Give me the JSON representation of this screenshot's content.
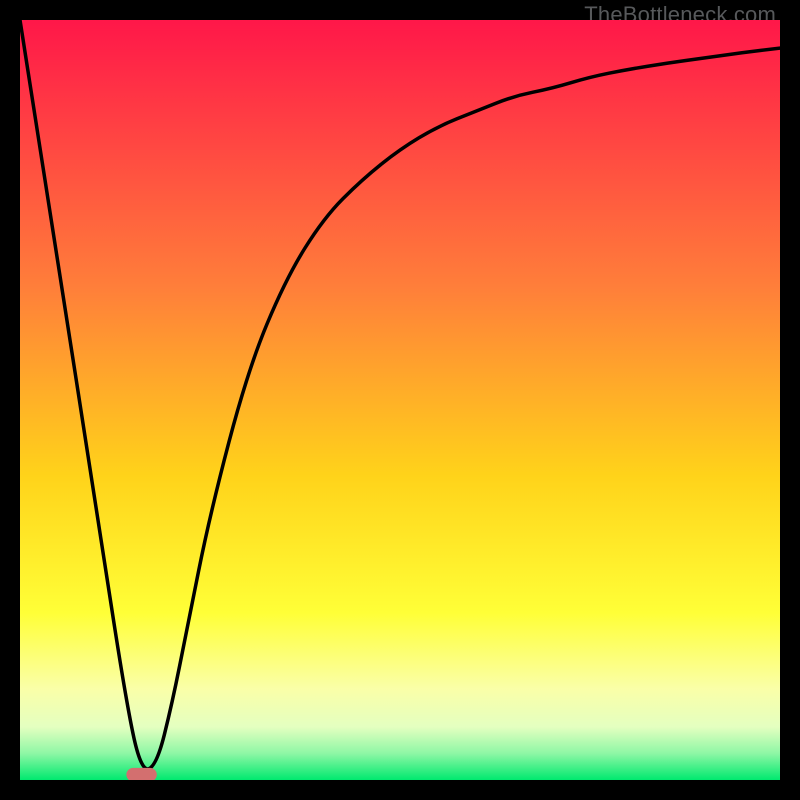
{
  "watermark": "TheBottleneck.com",
  "chart_data": {
    "type": "line",
    "title": "",
    "xlabel": "",
    "ylabel": "",
    "xlim": [
      0,
      100
    ],
    "ylim": [
      0,
      100
    ],
    "grid": false,
    "legend": false,
    "series": [
      {
        "name": "bottleneck-curve",
        "x": [
          0,
          5,
          10,
          14,
          16,
          18,
          20,
          22,
          25,
          30,
          35,
          40,
          45,
          50,
          55,
          60,
          65,
          70,
          75,
          80,
          85,
          90,
          95,
          100
        ],
        "y": [
          100,
          68,
          36,
          10,
          1,
          2,
          10,
          20,
          35,
          54,
          66,
          74,
          79,
          83,
          86,
          88,
          90,
          91,
          92.5,
          93.5,
          94.3,
          95,
          95.7,
          96.3
        ]
      }
    ],
    "marker": {
      "name": "optimal-marker",
      "x": 16,
      "y": 0.7,
      "width_pct": 4,
      "height_pct": 1.8,
      "color": "#d36f6f"
    },
    "gradient_stops": [
      {
        "offset": 0,
        "color": "#ff1749"
      },
      {
        "offset": 0.35,
        "color": "#ff7e3a"
      },
      {
        "offset": 0.6,
        "color": "#ffd31a"
      },
      {
        "offset": 0.78,
        "color": "#ffff37"
      },
      {
        "offset": 0.88,
        "color": "#faffa8"
      },
      {
        "offset": 0.93,
        "color": "#e4ffc0"
      },
      {
        "offset": 0.965,
        "color": "#8ef7a5"
      },
      {
        "offset": 1.0,
        "color": "#00e96f"
      }
    ]
  }
}
